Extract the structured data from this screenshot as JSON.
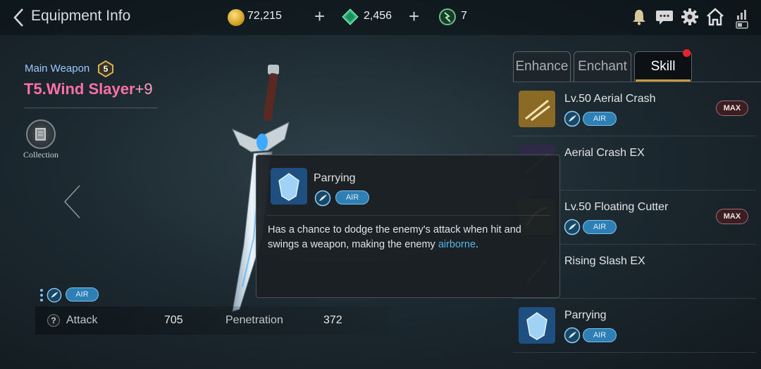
{
  "header": {
    "title": "Equipment Info",
    "gold": "72,215",
    "gems": "2,456",
    "stones": "7"
  },
  "weapon": {
    "type": "Main Weapon",
    "tier": "5",
    "name": "T5.Wind Slayer",
    "enhance": "+9",
    "collection_label": "Collection",
    "element": "AIR",
    "stats": [
      {
        "label": "Attack",
        "value": "705"
      },
      {
        "label": "Penetration",
        "value": "372"
      }
    ],
    "help": "?"
  },
  "tooltip": {
    "name": "Parrying",
    "element": "AIR",
    "desc_before": "Has a chance to dodge the enemy's attack when hit and swings a weapon, making the enemy ",
    "desc_highlight": "airborne",
    "desc_after": "."
  },
  "tabs": [
    {
      "label": "Enhance",
      "active": false
    },
    {
      "label": "Enchant",
      "active": false
    },
    {
      "label": "Skill",
      "active": true
    }
  ],
  "skills": [
    {
      "name": "Lv.50 Aerial Crash",
      "element": "AIR",
      "badge": "MAX"
    },
    {
      "name": "Aerial Crash EX",
      "element": "",
      "badge": ""
    },
    {
      "name": "Lv.50 Floating Cutter",
      "element": "AIR",
      "badge": "MAX"
    },
    {
      "name": "Rising Slash EX",
      "element": "",
      "badge": ""
    },
    {
      "name": "Parrying",
      "element": "AIR",
      "badge": ""
    }
  ],
  "colors": {
    "weapon_name": "#ff6fa8",
    "accent_blue": "#2e7fb4",
    "tab_underline": "#c89a3a",
    "notification": "#e8222a"
  },
  "icons": [
    "back-arrow-icon",
    "gold-coin-icon",
    "green-gem-icon",
    "green-stone-icon",
    "bell-icon",
    "chat-icon",
    "gear-icon",
    "home-icon",
    "signal-icon",
    "collection-book-icon",
    "air-element-icon",
    "parrying-skill-icon"
  ]
}
